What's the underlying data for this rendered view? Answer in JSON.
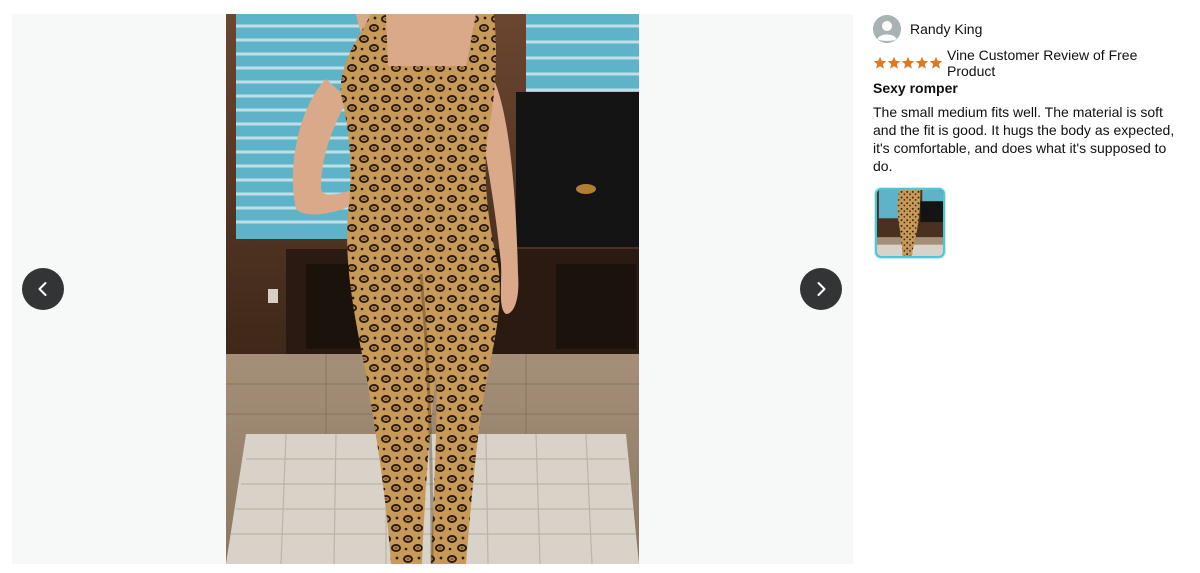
{
  "viewer": {
    "prev_button": "previous-image",
    "next_button": "next-image",
    "image_alt": "Customer photo of leopard print jumpsuit"
  },
  "review": {
    "reviewer_name": "Randy King",
    "rating": 5,
    "rating_max": 5,
    "vine_label": "Vine Customer Review of Free Product",
    "title": "Sexy romper",
    "body": "The small medium fits well. The material is soft and the fit is good. It hugs the body as expected, it's comfortable, and does what it's supposed to do.",
    "thumbnail_alt": "Review image thumbnail"
  },
  "colors": {
    "star": "#de7921",
    "nav_button": "#333435",
    "thumb_border": "#4fc6d3"
  },
  "icons": {
    "prev": "chevron-left-icon",
    "next": "chevron-right-icon",
    "avatar": "user-silhouette-icon",
    "star": "star-filled-icon"
  }
}
